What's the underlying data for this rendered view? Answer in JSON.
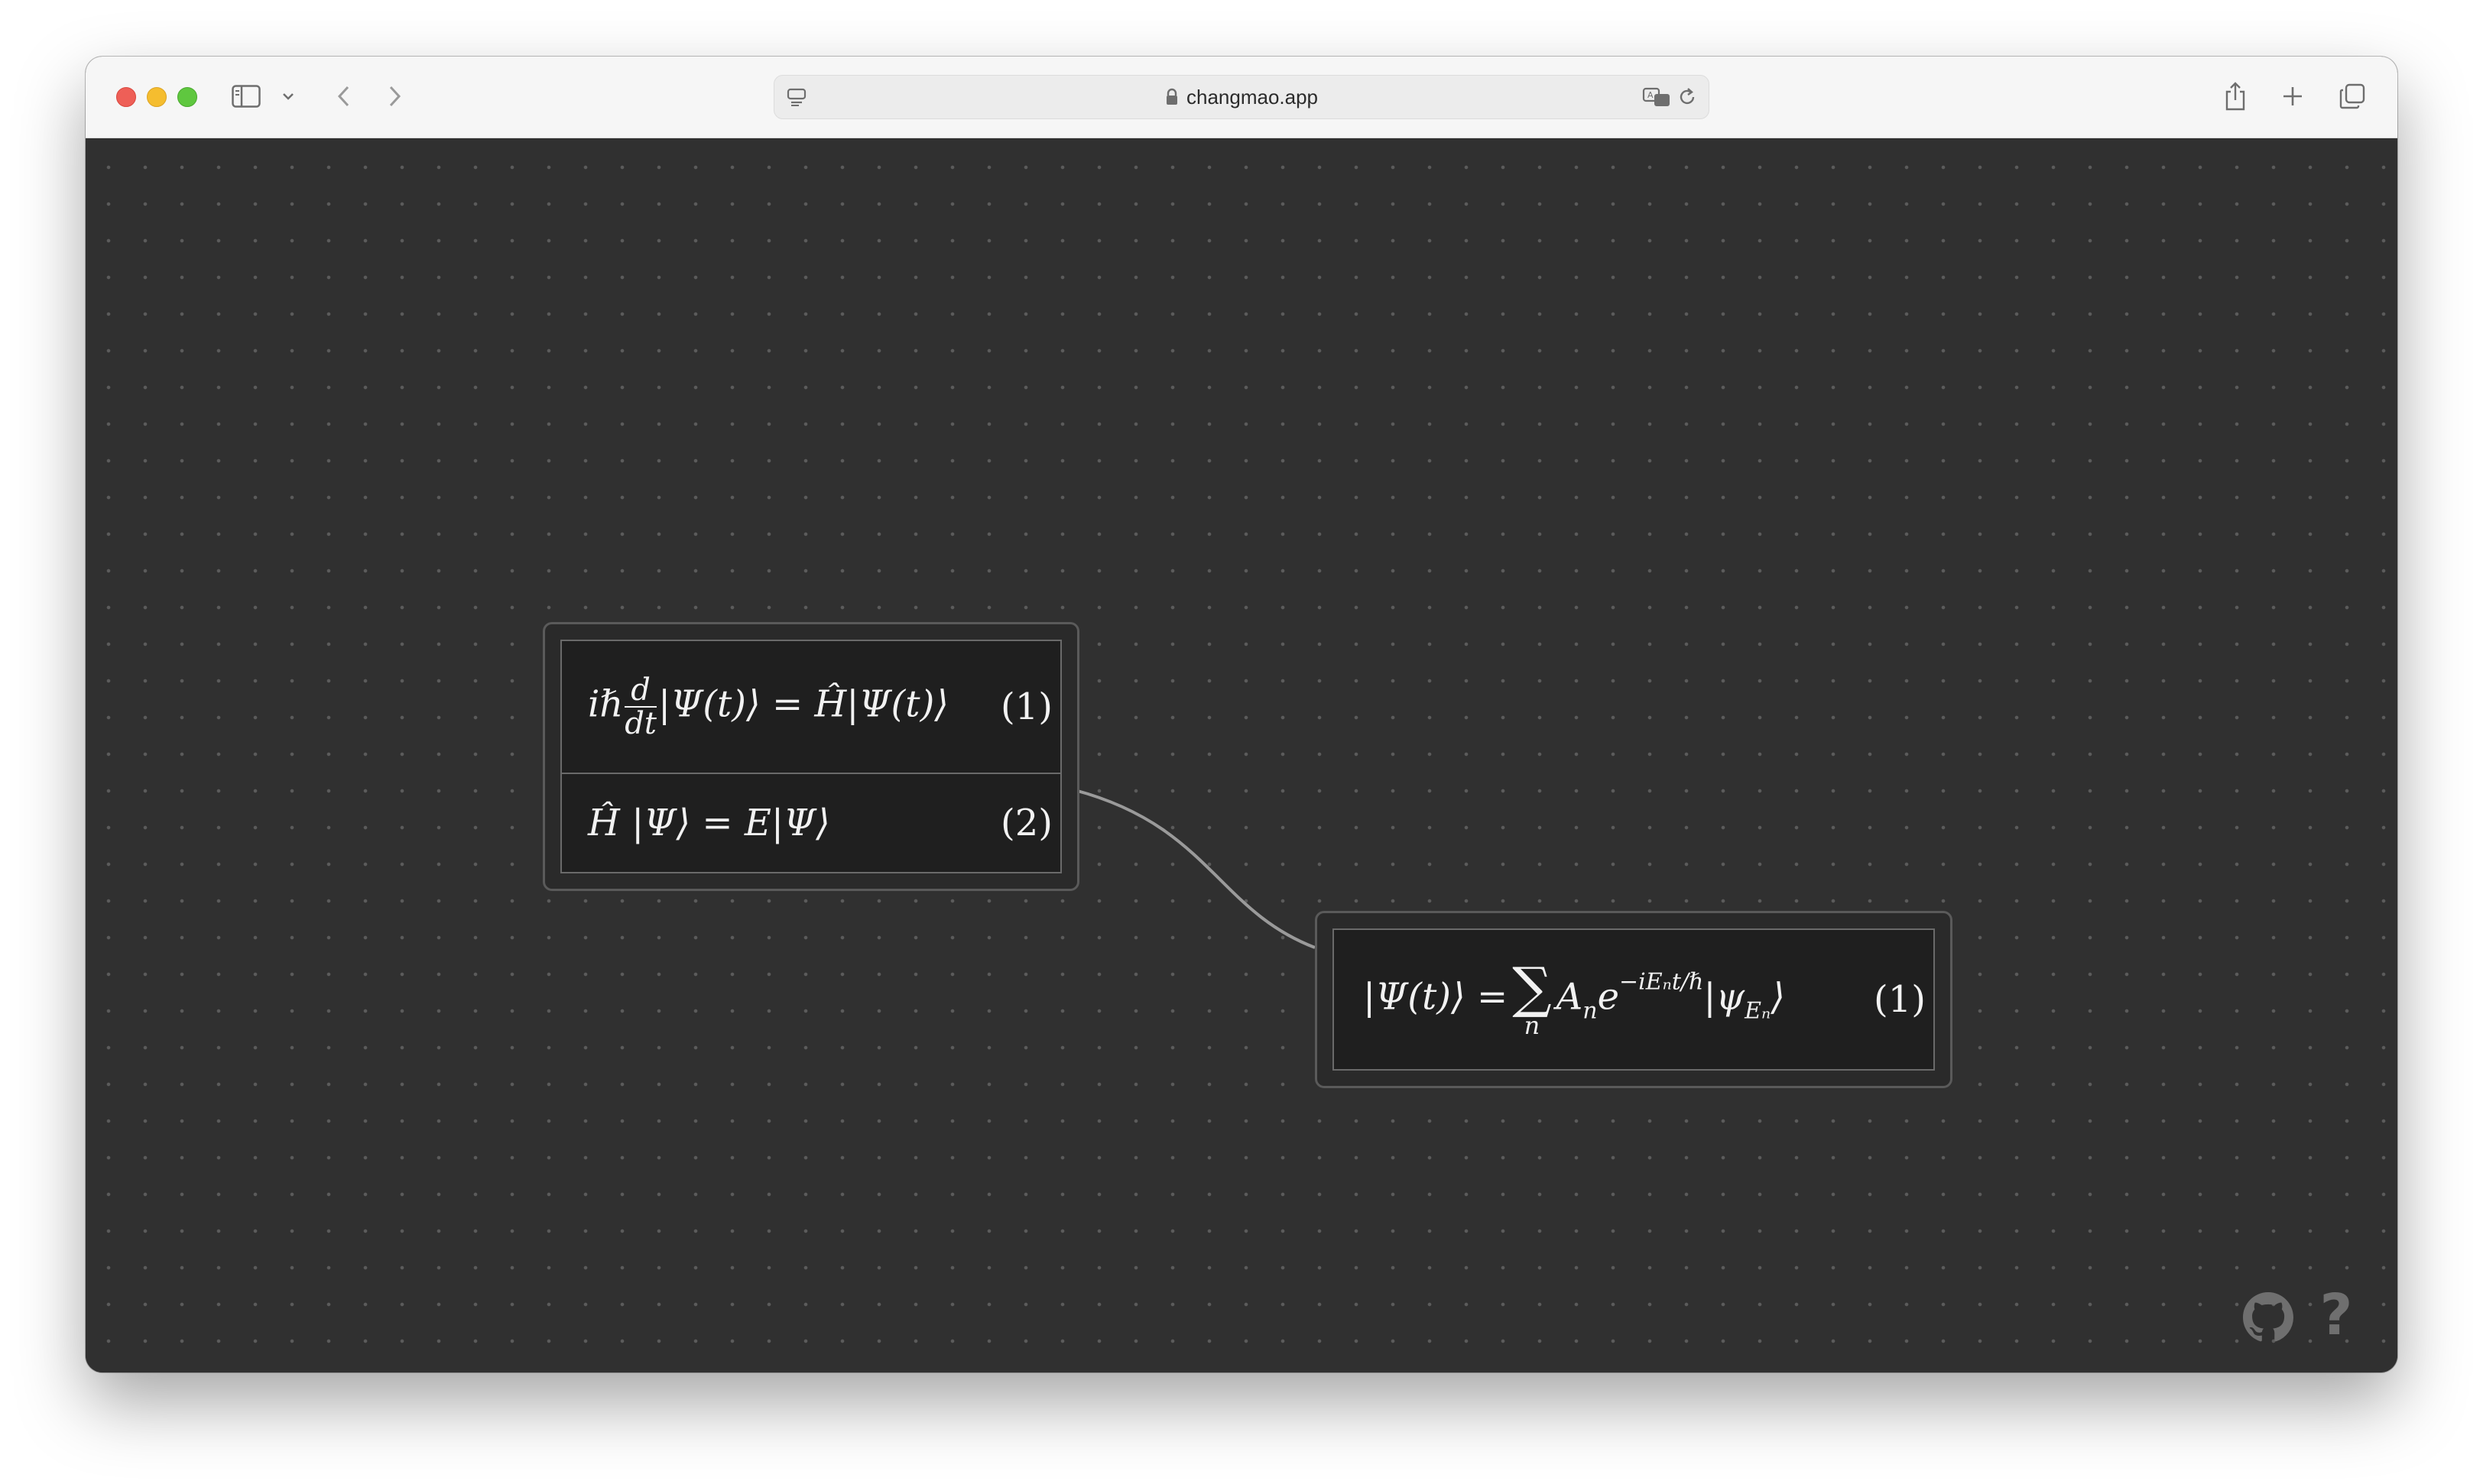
{
  "browser": {
    "url": "changmao.app",
    "icons": {
      "sidebar": "sidebar-toggle-icon",
      "chevron": "chevron-down-icon",
      "back": "back-arrow-icon",
      "forward": "forward-arrow-icon",
      "reader": "reader-mode-icon",
      "lock": "lock-icon",
      "translate": "translate-icon",
      "reload": "reload-icon",
      "share": "share-icon",
      "new_tab": "plus-icon",
      "tabs": "tab-overview-icon"
    }
  },
  "canvas": {
    "nodes": [
      {
        "equations": [
          {
            "label": "(1)"
          },
          {
            "label": "(2)"
          }
        ]
      },
      {
        "equations": [
          {
            "label": "(1)"
          }
        ]
      }
    ],
    "math_text": {
      "n1_e1": {
        "ih": "iℏ",
        "d": "d",
        "dt": "dt",
        "rest": "|Ψ(t)⟩ = Ĥ|Ψ(t)⟩"
      },
      "n1_e2": "Ĥ |Ψ⟩ = E|Ψ⟩",
      "n2_e1": {
        "lhs": "|Ψ(t)⟩ =",
        "sigma": "∑",
        "under": "n",
        "a": "A",
        "a_sub": "n",
        "e": "e",
        "exp": "−iEₙt/ℏ",
        "ket": "|ψ",
        "ket_sub": "Eₙ",
        "close": "⟩"
      }
    }
  },
  "footer_icons": {
    "github": "github-icon",
    "help_glyph": "?"
  },
  "colors": {
    "canvas_bg": "#303030",
    "node_border": "#5a5a5a",
    "edge": "#9a9a9a"
  }
}
